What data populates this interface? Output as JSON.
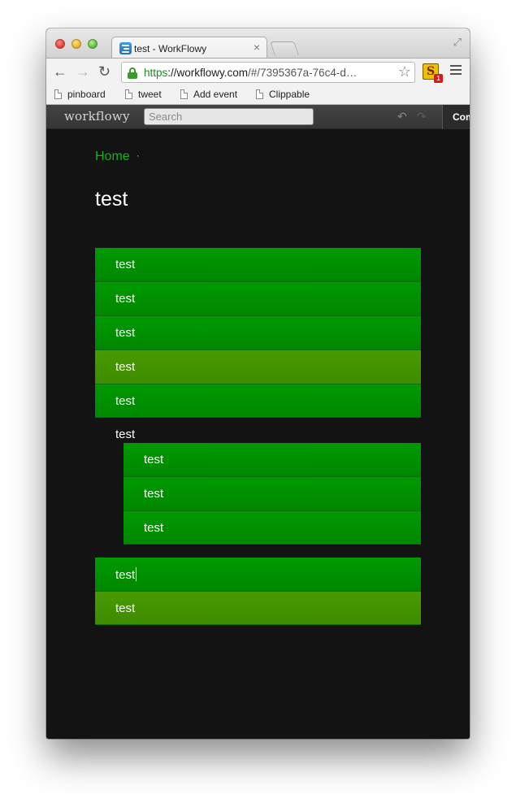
{
  "browser": {
    "tab_title": "test - WorkFlowy",
    "tab_close": "×",
    "url_scheme": "https",
    "url_host": "://workflowy.com",
    "url_path": "/#/7395367a-76c4-d…",
    "extension_letter": "S",
    "extension_badge": "1",
    "bookmarks": [
      "pinboard",
      "tweet",
      "Add event",
      "Clippable"
    ]
  },
  "workflowy": {
    "logo": "workflowy",
    "search_placeholder": "Search",
    "complete_label": "Com"
  },
  "page": {
    "breadcrumb_home": "Home",
    "breadcrumb_sep": "·",
    "title": "test",
    "group1": [
      "test",
      "test",
      "test",
      "test",
      "test"
    ],
    "parent_item": "test",
    "children": [
      "test",
      "test",
      "test"
    ],
    "group2": [
      "test",
      "test"
    ]
  },
  "colors": {
    "row_green": "#009200",
    "row_highlight": "#449400",
    "background": "#131313",
    "home_link": "#18b018"
  },
  "icons": [
    "back-icon",
    "forward-icon",
    "reload-icon",
    "lock-icon",
    "star-icon",
    "menu-icon",
    "undo-icon",
    "redo-icon"
  ]
}
